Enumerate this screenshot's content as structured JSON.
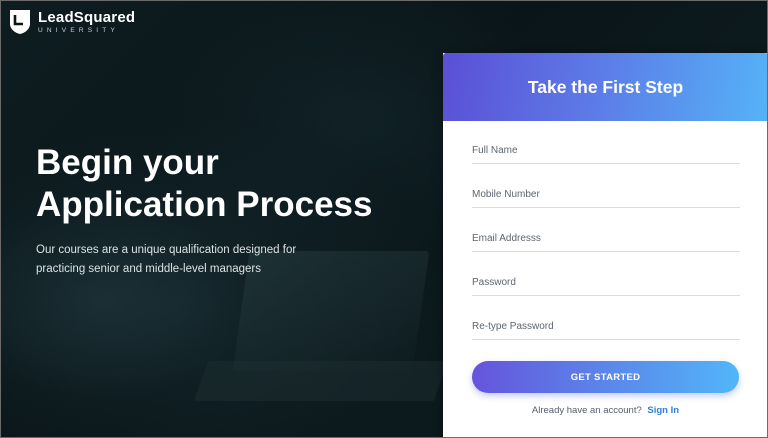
{
  "brand": {
    "name": "LeadSquared",
    "sub": "UNIVERSITY"
  },
  "hero": {
    "title_line1": "Begin your",
    "title_line2": "Application Process",
    "description": "Our courses are a unique qualification designed for practicing senior and middle-level managers"
  },
  "form": {
    "title": "Take the First Step",
    "full_name_placeholder": "Full Name",
    "mobile_placeholder": "Mobile Number",
    "email_placeholder": "Email Addresss",
    "password_placeholder": "Password",
    "retype_password_placeholder": "Re-type Password",
    "submit_label": "GET STARTED",
    "account_prompt": "Already have an account?",
    "signin_label": "Sign In"
  },
  "colors": {
    "header_gradient_start": "#5b4fd6",
    "header_gradient_end": "#55b3f7",
    "link": "#2f7fe0",
    "background": "#0b1518"
  },
  "icons": {
    "logo": "shield-icon"
  }
}
